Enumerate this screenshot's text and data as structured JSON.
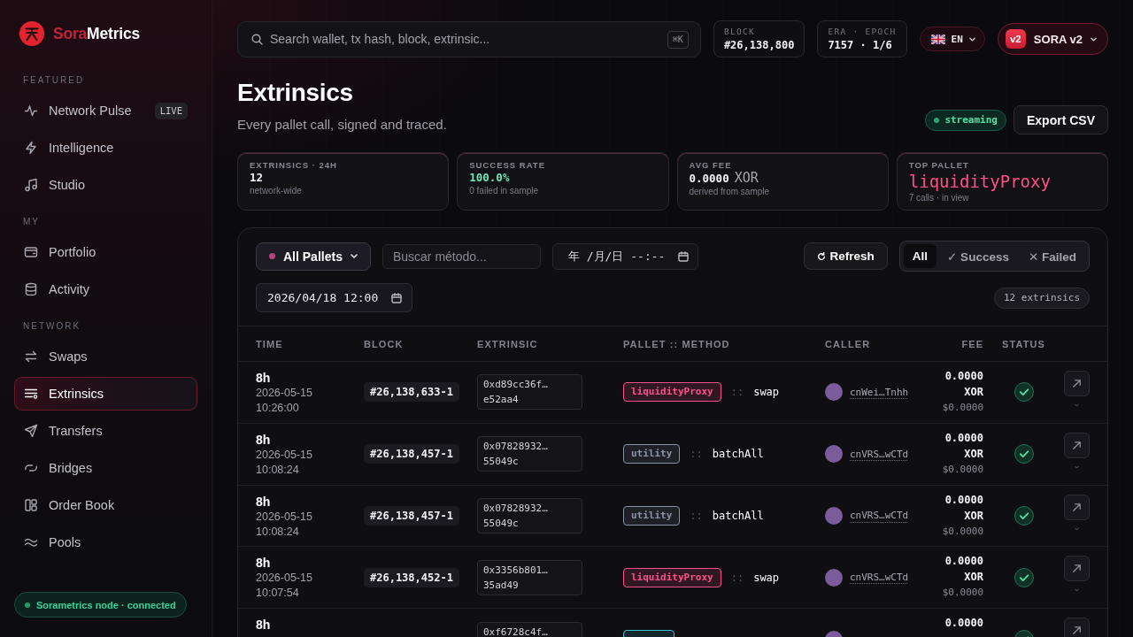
{
  "sidebar": {
    "brand": {
      "name_accent": "Sora",
      "name_rest": "Metrics"
    },
    "sections": [
      {
        "heading": "FEATURED",
        "items": [
          {
            "label": "Network Pulse",
            "badge": "LIVE",
            "selected": false
          },
          {
            "label": "Intelligence",
            "selected": false
          },
          {
            "label": "Studio",
            "selected": false
          }
        ]
      },
      {
        "heading": "MY",
        "items": [
          {
            "label": "Portfolio",
            "selected": false
          },
          {
            "label": "Activity",
            "selected": false
          }
        ]
      },
      {
        "heading": "NETWORK",
        "items": [
          {
            "label": "Swaps",
            "selected": false
          },
          {
            "label": "Extrinsics",
            "selected": true
          },
          {
            "label": "Transfers",
            "selected": false
          },
          {
            "label": "Bridges",
            "selected": false
          },
          {
            "label": "Order Book",
            "selected": false
          },
          {
            "label": "Pools",
            "selected": false
          }
        ]
      }
    ],
    "node_status": "Sorametrics node · connected"
  },
  "topbar": {
    "search": {
      "placeholder": "Search wallet, tx hash, block, extrinsic...",
      "shortcut": "⌘K"
    },
    "chips": [
      {
        "label": "BLOCK",
        "value": "#26,138,800"
      },
      {
        "label": "ERA · EPOCH",
        "value": "7157 · 1/6"
      }
    ],
    "language": "EN",
    "network": {
      "badge": "v2",
      "label": "SORA v2"
    }
  },
  "header": {
    "title": "Extrinsics",
    "subtitle": "Every pallet call, signed and traced.",
    "stream_badge": "streaming",
    "export_button": "Export CSV"
  },
  "summary_cards": [
    {
      "label": "EXTRINSICS · 24H",
      "value": "12",
      "note": "network-wide",
      "kind": "plain"
    },
    {
      "label": "SUCCESS RATE",
      "value": "100.0%",
      "note": "0 failed in sample",
      "kind": "positive"
    },
    {
      "label": "AVG FEE",
      "value": "0.0000",
      "unit": "XOR",
      "note": "derived from sample",
      "kind": "plain"
    },
    {
      "label": "TOP PALLET",
      "value": "liquidityProxy",
      "note": "7 calls · in view",
      "kind": "featured"
    }
  ],
  "filters": {
    "pallet_dropdown": "All Pallets",
    "method_search": {
      "placeholder": "Buscar método..."
    },
    "date_from": {
      "placeholder": "年 /月/日 --:--"
    },
    "date_to": {
      "value": "2026/04/18 12:00"
    },
    "refresh_button": "Refresh",
    "status_tabs": [
      {
        "label": "All",
        "selected": true
      },
      {
        "label": "✓ Success",
        "selected": false
      },
      {
        "label": "✕ Failed",
        "selected": false
      }
    ],
    "result_count": "12 extrinsics"
  },
  "table": {
    "columns": [
      "TIME",
      "BLOCK",
      "EXTRINSIC",
      "PALLET :: METHOD",
      "CALLER",
      "FEE",
      "STATUS"
    ],
    "rows": [
      {
        "age": "8h",
        "timestamp": "2026-05-15 10:26:00",
        "block": "#26,138,633-1",
        "hash": "0xd89cc36f…e52aa4",
        "pallet": {
          "name": "liquidityProxy",
          "color": "#ff4f8b"
        },
        "separator": "::",
        "method": "swap",
        "caller": "cnWei…Tnhh",
        "fee": "0.0000 XOR",
        "fee_usd": "$0.0000",
        "success": true
      },
      {
        "age": "8h",
        "timestamp": "2026-05-15 10:08:24",
        "block": "#26,138,457-1",
        "hash": "0x07828932…55049c",
        "pallet": {
          "name": "utility",
          "color": "#8a93a6"
        },
        "separator": "::",
        "method": "batchAll",
        "caller": "cnVRS…wCTd",
        "fee": "0.0000 XOR",
        "fee_usd": "$0.0000",
        "success": true
      },
      {
        "age": "8h",
        "timestamp": "2026-05-15 10:08:24",
        "block": "#26,138,457-1",
        "hash": "0x07828932…55049c",
        "pallet": {
          "name": "utility",
          "color": "#8a93a6"
        },
        "separator": "::",
        "method": "batchAll",
        "caller": "cnVRS…wCTd",
        "fee": "0.0000 XOR",
        "fee_usd": "$0.0000",
        "success": true
      },
      {
        "age": "8h",
        "timestamp": "2026-05-15 10:07:54",
        "block": "#26,138,452-1",
        "hash": "0x3356b801…35ad49",
        "pallet": {
          "name": "liquidityProxy",
          "color": "#ff4f8b"
        },
        "separator": "::",
        "method": "swap",
        "caller": "cnVRS…wCTd",
        "fee": "0.0000 XOR",
        "fee_usd": "$0.0000",
        "success": true
      },
      {
        "age": "8h",
        "hash": "0xf6728c4f…",
        "pallet": {
          "color": "#34c3d4"
        },
        "fee": "0.0000",
        "success": true
      }
    ]
  }
}
